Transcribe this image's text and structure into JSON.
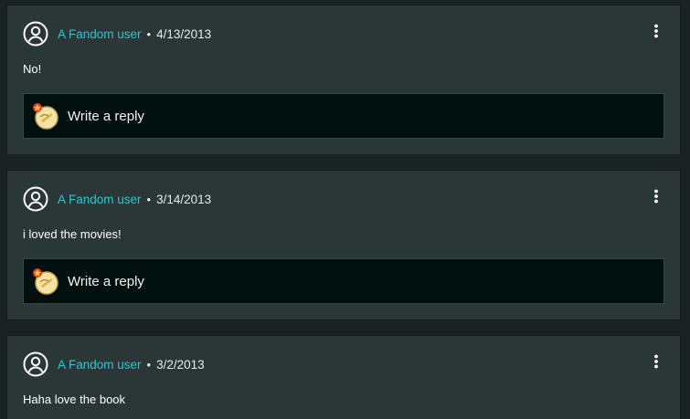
{
  "comments": [
    {
      "author": "A Fandom user",
      "separator": "•",
      "date": "4/13/2013",
      "text": "No!",
      "reply_placeholder": "Write a reply"
    },
    {
      "author": "A Fandom user",
      "separator": "•",
      "date": "3/14/2013",
      "text": "i loved the movies!",
      "reply_placeholder": "Write a reply"
    },
    {
      "author": "A Fandom user",
      "separator": "•",
      "date": "3/2/2013",
      "text": "Haha love the book"
    }
  ],
  "icons": {
    "avatar": "user-circle-icon",
    "menu": "more-vertical-icon",
    "reply_avatar": "badge-avatar-icon"
  },
  "colors": {
    "background": "#1b2222",
    "card": "#2b3636",
    "reply_box": "#020f0f",
    "username": "#2fc5cf",
    "text": "#ffffff"
  }
}
